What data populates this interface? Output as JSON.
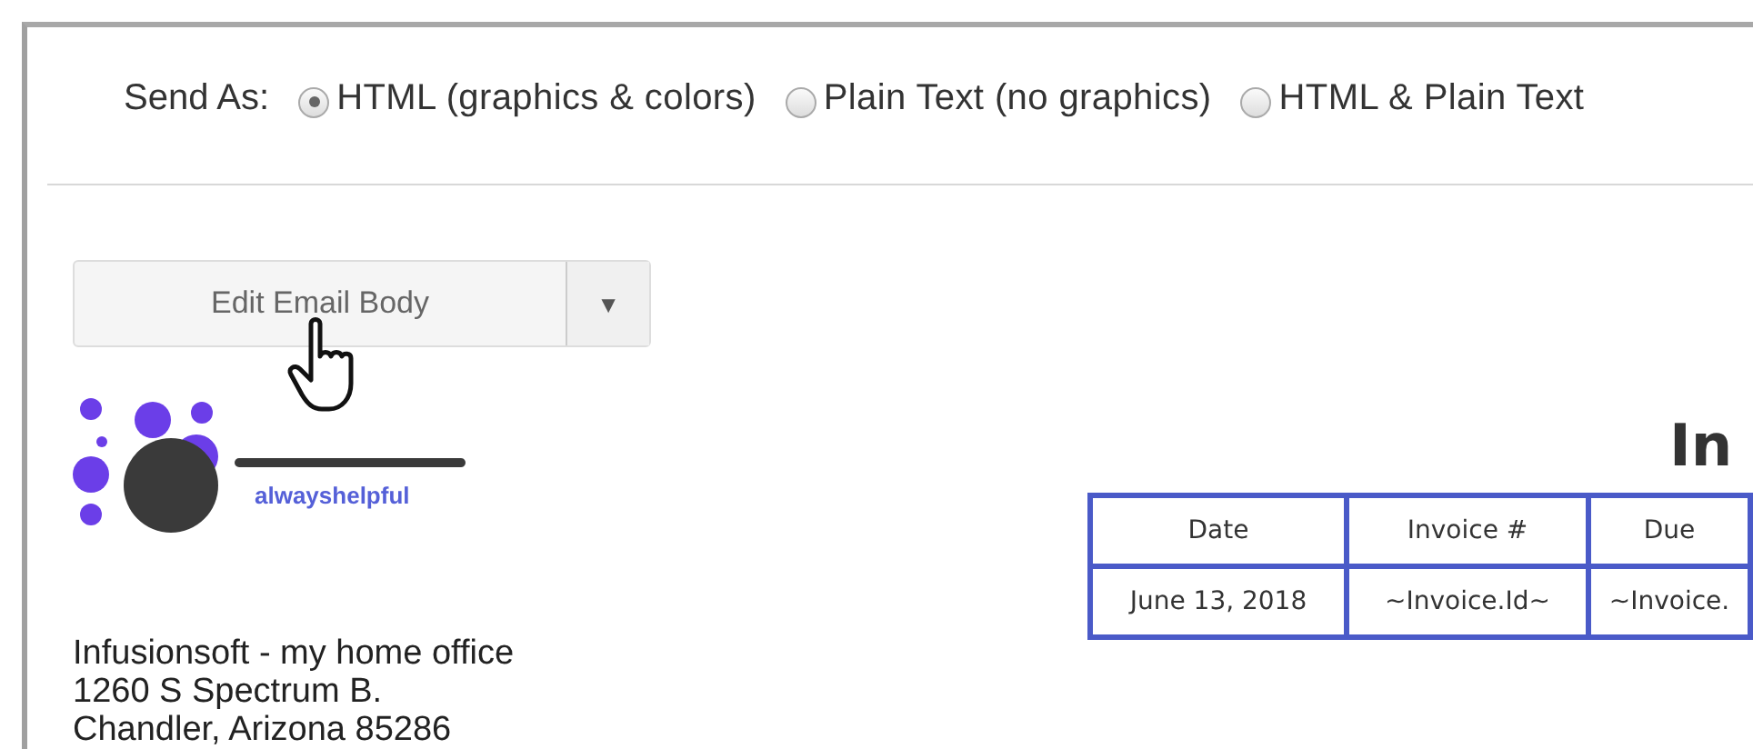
{
  "send_as": {
    "label": "Send As:",
    "options": [
      {
        "label": "HTML (graphics & colors)",
        "selected": true
      },
      {
        "label": "Plain Text (no graphics)",
        "selected": false
      },
      {
        "label": "HTML & Plain Text",
        "selected": false
      }
    ]
  },
  "edit_button": {
    "label": "Edit Email Body",
    "caret": "▼"
  },
  "logo": {
    "tagline": "alwayshelpful"
  },
  "address": [
    "Infusionsoft - my home office",
    "1260 S Spectrum B.",
    "Chandler, Arizona 85286"
  ],
  "invoice": {
    "title": "In",
    "columns": [
      "Date",
      "Invoice #",
      "Due"
    ],
    "rows": [
      [
        "June 13, 2018",
        "~Invoice.Id~",
        "~Invoice."
      ]
    ]
  }
}
